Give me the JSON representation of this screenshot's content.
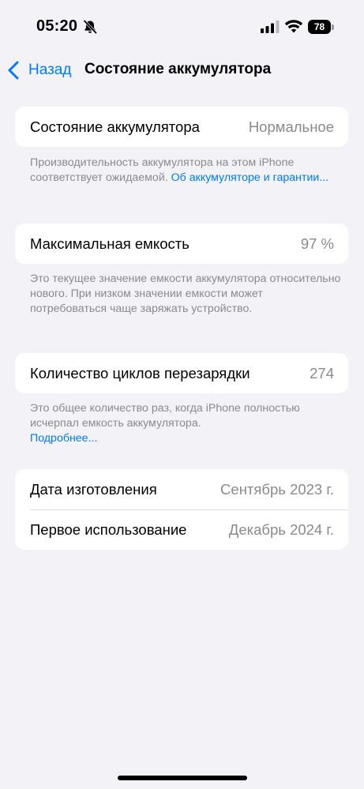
{
  "status_bar": {
    "time": "05:20",
    "battery_level": "78"
  },
  "nav": {
    "back_label": "Назад",
    "title": "Состояние аккумулятора"
  },
  "battery_health": {
    "label": "Состояние аккумулятора",
    "value": "Нормальное",
    "footnote_text": "Производительность аккумулятора на этом iPhone соответствует ожидаемой. ",
    "footnote_link": "Об аккумуляторе и гарантии..."
  },
  "max_capacity": {
    "label": "Максимальная емкость",
    "value": "97 %",
    "footnote_text": "Это текущее значение емкости аккумулятора относительно нового. При низком значении емкости может потребоваться чаще заряжать устройство."
  },
  "cycle_count": {
    "label": "Количество циклов перезарядки",
    "value": "274",
    "footnote_text": "Это общее количество раз, когда iPhone полностью исчерпал емкость аккумулятора.",
    "footnote_link": "Подробнее..."
  },
  "dates": {
    "manufacture_label": "Дата изготовления",
    "manufacture_value": "Сентябрь 2023 г.",
    "first_use_label": "Первое использование",
    "first_use_value": "Декабрь 2024 г."
  },
  "colors": {
    "accent": "#007aff",
    "background": "#f2f2f7",
    "secondary_text": "#8a8a8e"
  },
  "icons": [
    "bell-slash-icon",
    "cellular-signal-icon",
    "wifi-icon",
    "battery-icon",
    "chevron-left-icon"
  ]
}
